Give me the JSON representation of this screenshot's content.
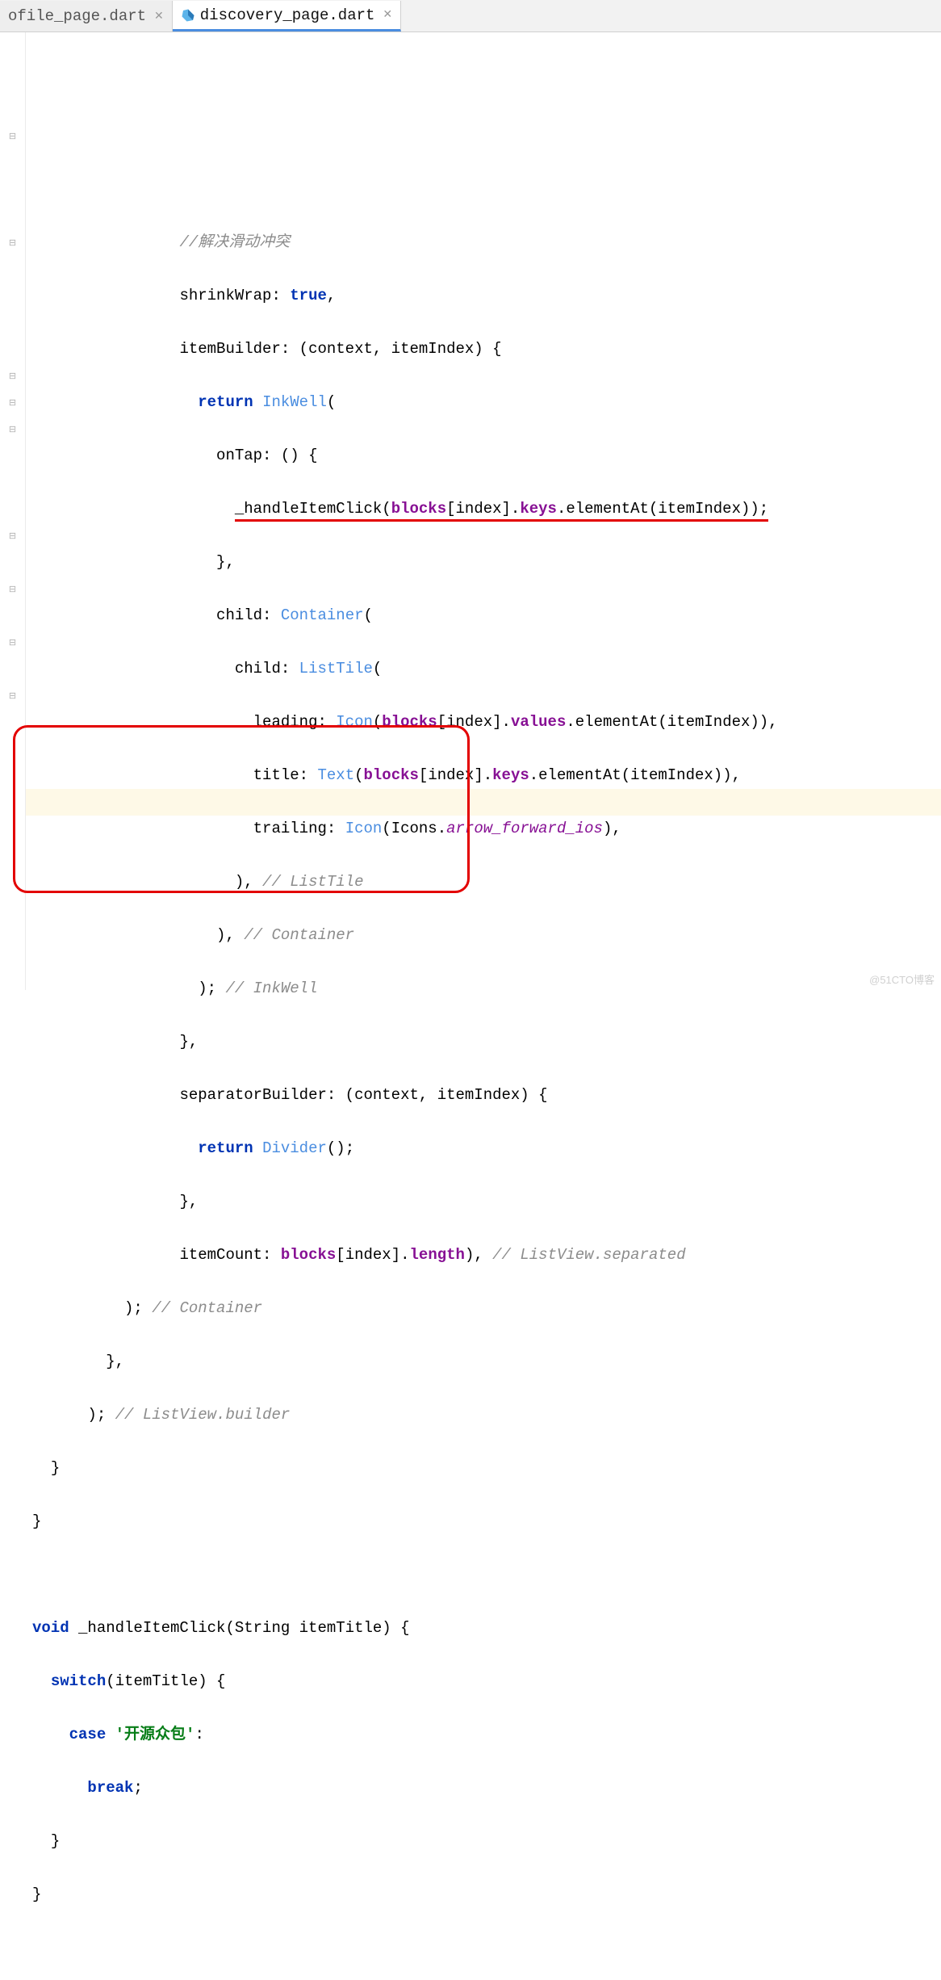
{
  "tabs": [
    {
      "label": "ofile_page.dart",
      "active": false
    },
    {
      "label": "discovery_page.dart",
      "active": true
    }
  ],
  "code": {
    "comment_scroll": "//解决滑动冲突",
    "shrinkwrap_label": "shrinkWrap:",
    "true_kw": "true",
    "itembuilder": "itemBuilder: (context, itemIndex) {",
    "return_kw": "return",
    "inkwell": "InkWell",
    "ontap": "onTap: () {",
    "handle_call_pre": "_handleItemClick(",
    "blocks": "blocks",
    "index_br": "[index].",
    "keys": "keys",
    "elementat_itemindex": ".elementAt(itemIndex));",
    "close_brace_comma": "},",
    "child_label": "child:",
    "container": "Container",
    "listtile": "ListTile",
    "leading": "leading:",
    "icon": "Icon",
    "values": "values",
    "elementat_itemindex_p": ".elementAt(itemIndex)),",
    "title": "title:",
    "text": "Text",
    "trailing": "trailing:",
    "icons_arrow": "Icons.",
    "arrow_prop": "arrow_forward_ios",
    "close_paren_comma": "),",
    "comment_listtile": " // ListTile",
    "comment_container": " // Container",
    "close_paren_semi": ");",
    "comment_inkwell": " // InkWell",
    "separator": "separatorBuilder: (context, itemIndex) {",
    "divider": "Divider",
    "divider_call": "();",
    "itemcount": "itemCount:",
    "length": "length",
    "close_p": "),",
    "comment_listview_sep": " // ListView.separated",
    "comment_container2": " // Container",
    "comment_listview_builder": " // ListView.builder",
    "close_brace": "}",
    "void_kw": "void",
    "handle_sig": " _handleItemClick(String itemTitle) {",
    "switch_kw": "switch",
    "switch_args": "(itemTitle) {",
    "case_kw": "case",
    "case_str": "'开源众包'",
    "colon": ":",
    "break_kw": "break",
    "semi": ";"
  },
  "watermark": "@51CTO博客"
}
